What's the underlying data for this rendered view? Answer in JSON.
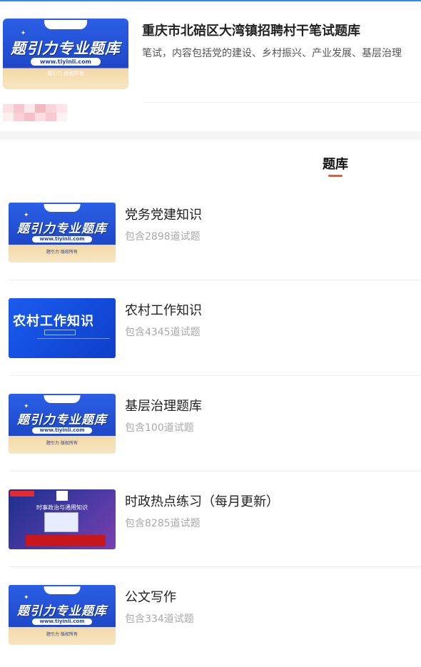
{
  "header": {
    "title": "重庆市北碚区大湾镇招聘村干笔试题库",
    "description": "笔试，内容包括党的建设、乡村振兴、产业发展、基层治理"
  },
  "cover": {
    "headline": "题引力专业题库",
    "url": "www.tiyinli.com",
    "copyright": "题引力 版权所有"
  },
  "tabs": [
    {
      "label": "题库",
      "active": true
    }
  ],
  "items": [
    {
      "name": "党务党建知识",
      "count": "包含2898道试题",
      "cover": "tiyinli-cover"
    },
    {
      "name": "农村工作知识",
      "count": "包含4345道试题",
      "cover": "rural-work-cover",
      "cover_title": "农村工作知识"
    },
    {
      "name": "基层治理题库",
      "count": "包含100道试题",
      "cover": "tiyinli-cover"
    },
    {
      "name": "时政热点练习（每月更新）",
      "count": "包含8285道试题",
      "cover": "current-affairs-cover",
      "cover_title": "时事政治与通用知识"
    },
    {
      "name": "公文写作",
      "count": "包含334道试题",
      "cover": "tiyinli-cover"
    }
  ],
  "colors": {
    "accent": "#2f8cf0",
    "tab_underline": "#f05a28",
    "cover_blue": "#2a5fe6"
  }
}
